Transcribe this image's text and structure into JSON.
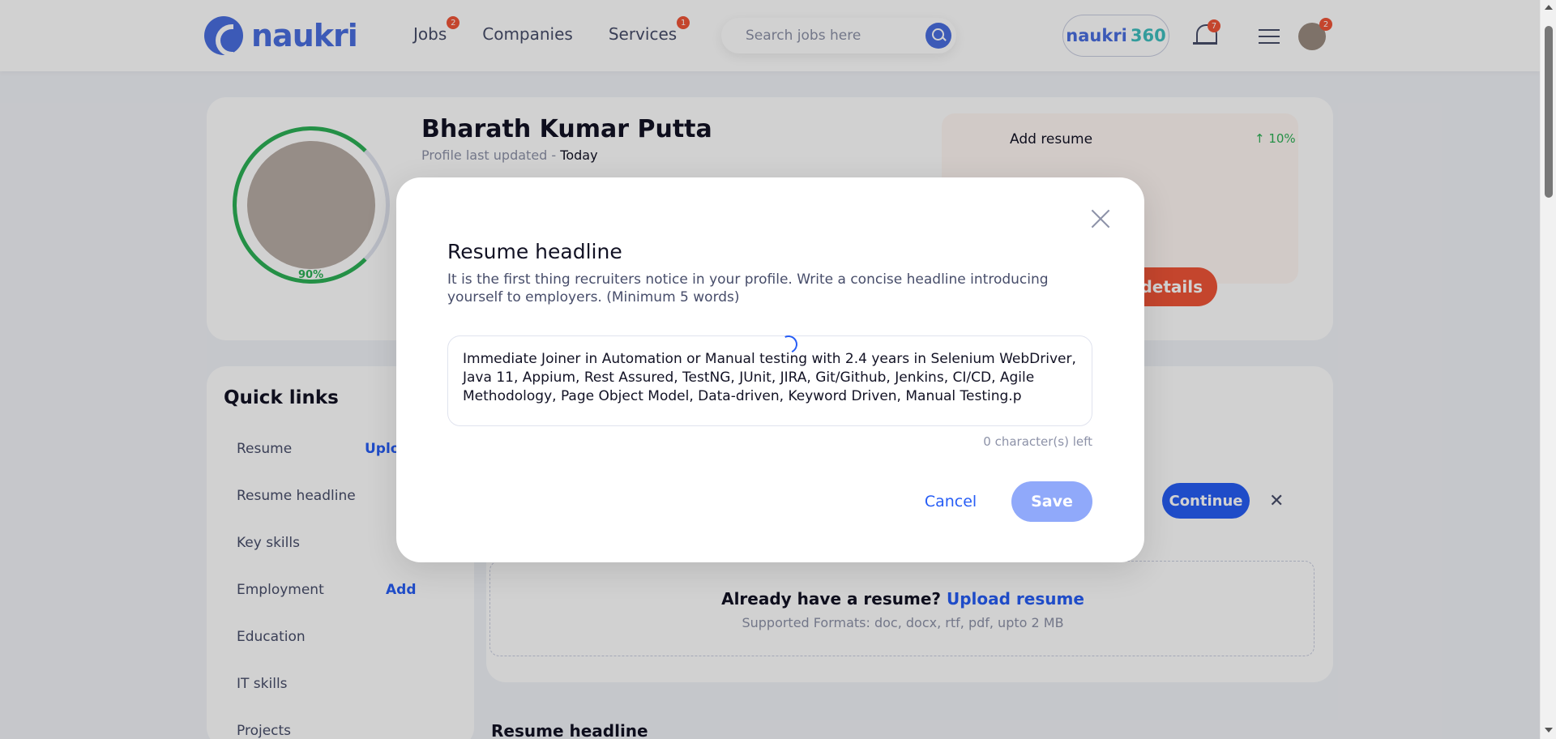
{
  "header": {
    "logo_text": "naukri",
    "nav": [
      {
        "label": "Jobs",
        "badge": "2"
      },
      {
        "label": "Companies",
        "badge": ""
      },
      {
        "label": "Services",
        "badge": "1"
      }
    ],
    "search_placeholder": "Search jobs here",
    "n360_text": "naukri",
    "n360_num": "360",
    "bell_badge": "7",
    "avatar_badge": "2"
  },
  "profile": {
    "name": "Bharath Kumar Putta",
    "updated_label": "Profile last updated -",
    "updated_value": "Today",
    "completion": "90%",
    "pending_item": "Add resume",
    "pending_boost": "↑ 10%",
    "cta": "details"
  },
  "quick_links": {
    "title": "Quick links",
    "items": [
      {
        "label": "Resume",
        "action": "Upload"
      },
      {
        "label": "Resume headline",
        "action": ""
      },
      {
        "label": "Key skills",
        "action": ""
      },
      {
        "label": "Employment",
        "action": "Add"
      },
      {
        "label": "Education",
        "action": ""
      },
      {
        "label": "IT skills",
        "action": ""
      },
      {
        "label": "Projects",
        "action": ""
      }
    ]
  },
  "resume_section": {
    "continue_label": "Continue",
    "already": "Already have a resume?",
    "upload_link": "Upload resume",
    "formats": "Supported Formats: doc, docx, rtf, pdf, upto 2 MB",
    "headline_title": "Resume headline"
  },
  "modal": {
    "title": "Resume headline",
    "description": "It is the first thing recruiters notice in your profile. Write a concise headline introducing yourself to employers. (Minimum 5 words)",
    "textarea_value": "Immediate Joiner in Automation or Manual testing with 2.4 years in Selenium WebDriver, Java 11, Appium, Rest Assured, TestNG, JUnit, JIRA, Git/Github, Jenkins, CI/CD, Agile Methodology, Page Object Model, Data-driven, Keyword Driven, Manual Testing.p",
    "char_count": "0 character(s) left",
    "cancel_label": "Cancel",
    "save_label": "Save"
  },
  "colors": {
    "accent": "#275df5",
    "save_disabled": "#90a9fa",
    "badge": "#f05537",
    "progress": "#2cb056"
  }
}
